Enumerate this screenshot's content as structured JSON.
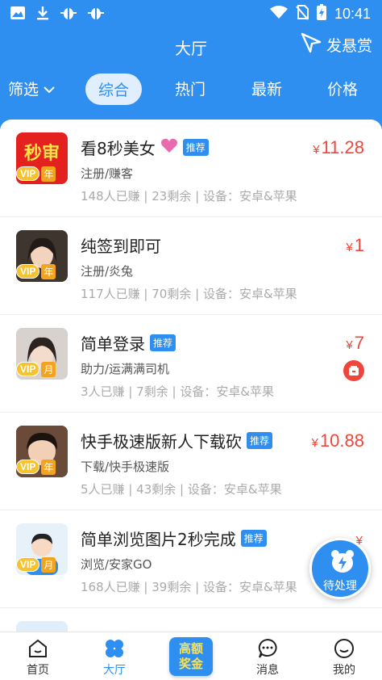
{
  "status_bar": {
    "time": "10:41",
    "icons": [
      "image-icon",
      "download-icon",
      "bug-icon",
      "bug-icon",
      "wifi-icon",
      "no-sim-icon",
      "battery-icon"
    ]
  },
  "header": {
    "title": "大厅",
    "bounty_label": "发悬赏"
  },
  "filters": {
    "select_label": "筛选",
    "tabs": [
      {
        "label": "综合",
        "active": true
      },
      {
        "label": "热门",
        "active": false
      },
      {
        "label": "最新",
        "active": false
      },
      {
        "label": "价格",
        "active": false
      }
    ]
  },
  "tasks": [
    {
      "title": "看8秒美女",
      "title_icon": "heart-icon",
      "badge": "推荐",
      "sub": "注册/赚客",
      "earned": "148人已赚",
      "remaining": "23剩余",
      "device": "设备：安卓&苹果",
      "currency": "¥",
      "price": "11.28",
      "vip_period": "年",
      "thumb_text": "秒审"
    },
    {
      "title": "纯签到即可",
      "badge": "",
      "sub": "注册/炎兔",
      "earned": "117人已赚",
      "remaining": "70剩余",
      "device": "设备：安卓&苹果",
      "currency": "¥",
      "price": "1",
      "vip_period": "年"
    },
    {
      "title": "简单登录",
      "badge": "推荐",
      "sub": "助力/运满满司机",
      "earned": "3人已赚",
      "remaining": "7剩余",
      "device": "设备：安卓&苹果",
      "currency": "¥",
      "price": "7",
      "vip_period": "月"
    },
    {
      "title": "快手极速版新人下载砍",
      "badge": "推荐",
      "sub": "下载/快手极速版",
      "earned": "5人已赚",
      "remaining": "43剩余",
      "device": "设备：安卓&苹果",
      "currency": "¥",
      "price": "10.88",
      "vip_period": "年"
    },
    {
      "title": "简单浏览图片2秒完成",
      "badge": "推荐",
      "sub": "浏览/安家GO",
      "earned": "168人已赚",
      "remaining": "39剩余",
      "device": "设备：安卓&苹果",
      "currency": "¥",
      "price": "",
      "vip_period": "月"
    }
  ],
  "vip_label": "VIP",
  "separator": "|",
  "floating_button": {
    "label": "待处理"
  },
  "bottom_nav": {
    "items": [
      {
        "label": "首页",
        "icon": "home-icon"
      },
      {
        "label": "大厅",
        "icon": "hall-icon",
        "active": true
      },
      {
        "label": "高额奖金",
        "icon": "high-reward-icon"
      },
      {
        "label": "消息",
        "icon": "message-icon"
      },
      {
        "label": "我的",
        "icon": "profile-icon"
      }
    ],
    "center_line1": "高额",
    "center_line2": "奖金"
  },
  "colors": {
    "primary": "#2e8ff0",
    "price": "#f0453a",
    "vip": "#f6c32e"
  }
}
